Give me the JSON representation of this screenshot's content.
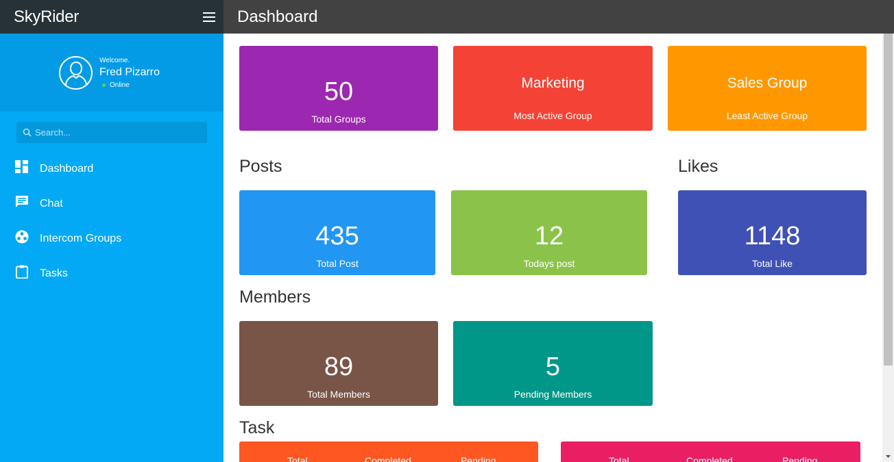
{
  "app": {
    "brand": "SkyRider",
    "page_title": "Dashboard"
  },
  "profile": {
    "welcome": "Welcome.",
    "name": "Fred Pizarro",
    "status": "Online"
  },
  "search": {
    "placeholder": "Search..."
  },
  "nav": {
    "items": [
      {
        "label": "Dashboard",
        "icon": "dashboard-icon"
      },
      {
        "label": "Chat",
        "icon": "chat-icon"
      },
      {
        "label": "Intercom Groups",
        "icon": "groups-icon"
      },
      {
        "label": "Tasks",
        "icon": "clipboard-icon"
      }
    ]
  },
  "groups": {
    "total": {
      "value": "50",
      "label": "Total Groups",
      "color": "#9c27b0"
    },
    "most_active": {
      "value": "Marketing",
      "label": "Most Active Group",
      "color": "#f44336"
    },
    "least_active": {
      "value": "Sales Group",
      "label": "Least Active Group",
      "color": "#ff9800"
    }
  },
  "posts": {
    "title": "Posts",
    "total": {
      "value": "435",
      "label": "Total Post",
      "color": "#2196f3"
    },
    "today": {
      "value": "12",
      "label": "Todays post",
      "color": "#8bc34a"
    }
  },
  "likes": {
    "title": "Likes",
    "total": {
      "value": "1148",
      "label": "Total Like",
      "color": "#3f51b5"
    }
  },
  "members": {
    "title": "Members",
    "total": {
      "value": "89",
      "label": "Total Members",
      "color": "#795548"
    },
    "pending": {
      "value": "5",
      "label": "Pending Members",
      "color": "#009688"
    }
  },
  "tasks": {
    "title": "Task",
    "cards": [
      {
        "color": "#ff5722",
        "columns": [
          "Total",
          "Completed",
          "Pending"
        ]
      },
      {
        "color": "#e91e63",
        "columns": [
          "Total",
          "Completed",
          "Pending"
        ]
      }
    ]
  }
}
